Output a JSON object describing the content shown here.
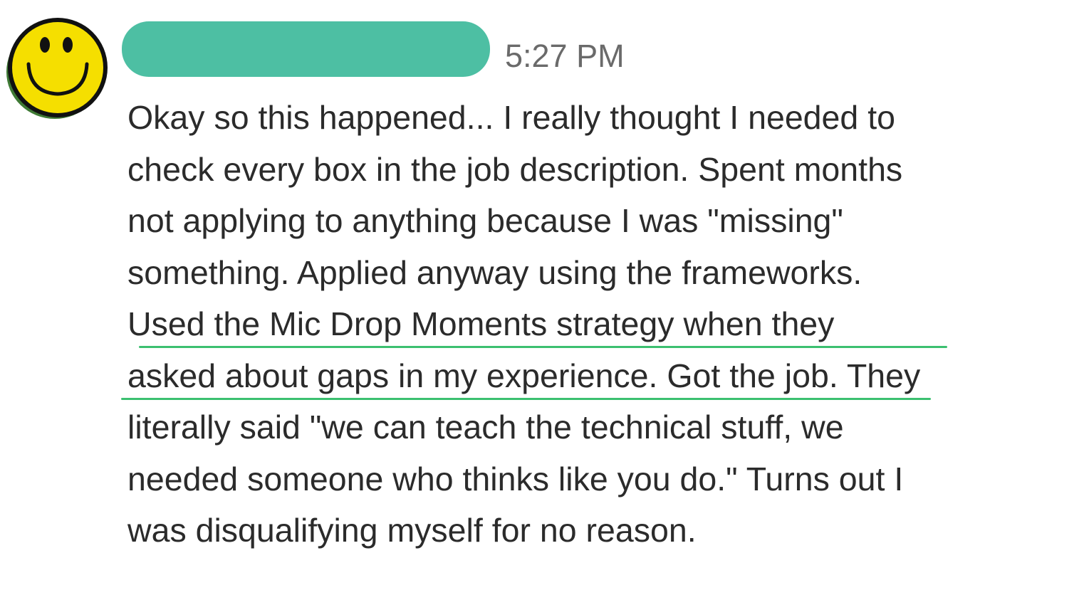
{
  "colors": {
    "name_redaction": "#4dbfa3",
    "highlight_underline": "#3cc070",
    "avatar_face": "#f5df00"
  },
  "message": {
    "avatar_icon": "smiley-face-icon",
    "timestamp": "5:27 PM",
    "body_lines": [
      "Okay so this happened... I really thought I needed to",
      "check every box in the job description. Spent months",
      "not applying to anything because I was \"missing\"",
      "something. Applied anyway using the frameworks.",
      "Used the Mic Drop Moments strategy when they",
      "asked about gaps in my experience. Got the job. They",
      "literally said \"we can teach the technical stuff, we",
      "needed someone who thinks like you do.\" Turns out I",
      "was disqualifying myself for no reason."
    ]
  }
}
